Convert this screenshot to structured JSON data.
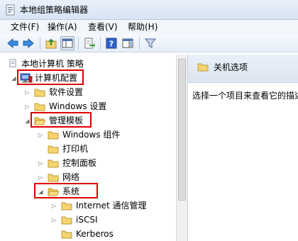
{
  "window": {
    "title": "本地组策略编辑器"
  },
  "menu": [
    "文件(F)",
    "操作(A)",
    "查看(V)",
    "帮助(H)"
  ],
  "toolbar": {
    "buttons": [
      "back-icon",
      "forward-icon",
      "up-folder-icon",
      "show-hide-tree-icon",
      "export-list-icon",
      "help-icon",
      "show-hide-action-pane-icon",
      "filter-icon"
    ]
  },
  "tree": {
    "root": "本地计算机 策略",
    "computer_config": "计算机配置",
    "software_settings": "软件设置",
    "windows_settings": "Windows 设置",
    "admin_templates": "管理模板",
    "windows_components": "Windows 组件",
    "printers": "打印机",
    "control_panel": "控制面板",
    "network": "网络",
    "system": "系统",
    "internet_comm": "Internet 通信管理",
    "iscsi": "iSCSI",
    "kerberos": "Kerberos"
  },
  "right_pane": {
    "title": "关机选项",
    "description": "选择一个项目来查看它的描述。"
  },
  "colors": {
    "highlight_box": "#e00000",
    "folder": "#f5d470"
  }
}
